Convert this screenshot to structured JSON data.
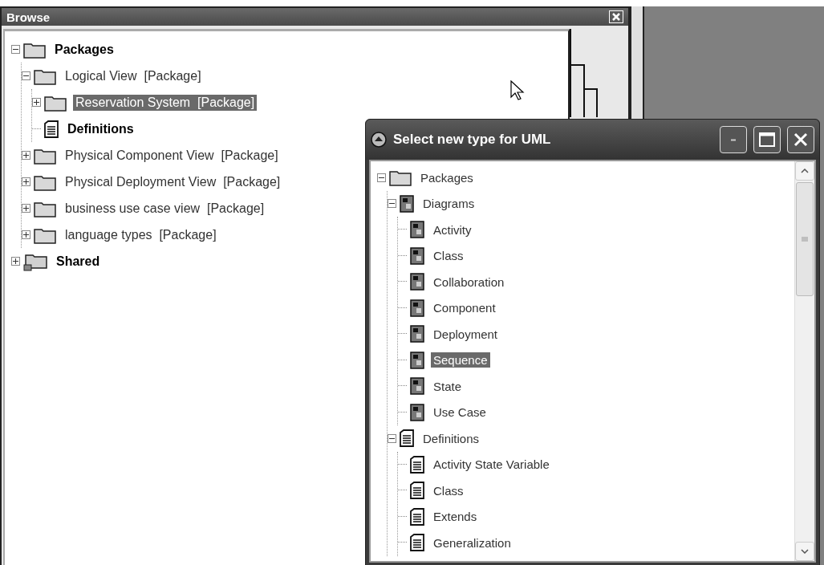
{
  "browse": {
    "title": "Browse",
    "tree": [
      {
        "label": "Packages",
        "kind": "folder",
        "bold": true,
        "selected": false,
        "expanded": true,
        "children": [
          {
            "label": "Logical View  [Package]",
            "kind": "folder",
            "bold": false,
            "selected": false,
            "expanded": true,
            "children": [
              {
                "label": "Reservation System  [Package]",
                "kind": "folder",
                "bold": false,
                "selected": true,
                "expanded": false
              },
              {
                "label": "Definitions",
                "kind": "definition",
                "bold": true,
                "selected": false
              }
            ]
          },
          {
            "label": "Physical Component View  [Package]",
            "kind": "folder",
            "bold": false,
            "selected": false,
            "expanded": false
          },
          {
            "label": "Physical Deployment View  [Package]",
            "kind": "folder",
            "bold": false,
            "selected": false,
            "expanded": false
          },
          {
            "label": "business use case view  [Package]",
            "kind": "folder",
            "bold": false,
            "selected": false,
            "expanded": false
          },
          {
            "label": "language types  [Package]",
            "kind": "folder",
            "bold": false,
            "selected": false,
            "expanded": false
          }
        ]
      },
      {
        "label": "Shared",
        "kind": "shared",
        "bold": true,
        "selected": false,
        "expanded": false
      }
    ]
  },
  "dialog": {
    "title": "Select new type for UML",
    "tree": [
      {
        "label": "Packages",
        "kind": "folder",
        "bold": false,
        "selected": false,
        "expanded": true,
        "children": [
          {
            "label": "Diagrams",
            "kind": "diagram",
            "bold": false,
            "selected": false,
            "expanded": true,
            "children": [
              {
                "label": "Activity",
                "kind": "diagram",
                "bold": false,
                "selected": false
              },
              {
                "label": "Class",
                "kind": "diagram",
                "bold": false,
                "selected": false
              },
              {
                "label": "Collaboration",
                "kind": "diagram",
                "bold": false,
                "selected": false
              },
              {
                "label": "Component",
                "kind": "diagram",
                "bold": false,
                "selected": false
              },
              {
                "label": "Deployment",
                "kind": "diagram",
                "bold": false,
                "selected": false
              },
              {
                "label": "Sequence",
                "kind": "diagram",
                "bold": false,
                "selected": true
              },
              {
                "label": "State",
                "kind": "diagram",
                "bold": false,
                "selected": false
              },
              {
                "label": "Use Case",
                "kind": "diagram",
                "bold": false,
                "selected": false
              }
            ]
          },
          {
            "label": "Definitions",
            "kind": "definition",
            "bold": false,
            "selected": false,
            "expanded": true,
            "children": [
              {
                "label": "Activity State Variable",
                "kind": "definition",
                "bold": false,
                "selected": false
              },
              {
                "label": "Class",
                "kind": "definition",
                "bold": false,
                "selected": false
              },
              {
                "label": "Extends",
                "kind": "definition",
                "bold": false,
                "selected": false
              },
              {
                "label": "Generalization",
                "kind": "definition",
                "bold": false,
                "selected": false
              }
            ]
          }
        ]
      }
    ]
  }
}
